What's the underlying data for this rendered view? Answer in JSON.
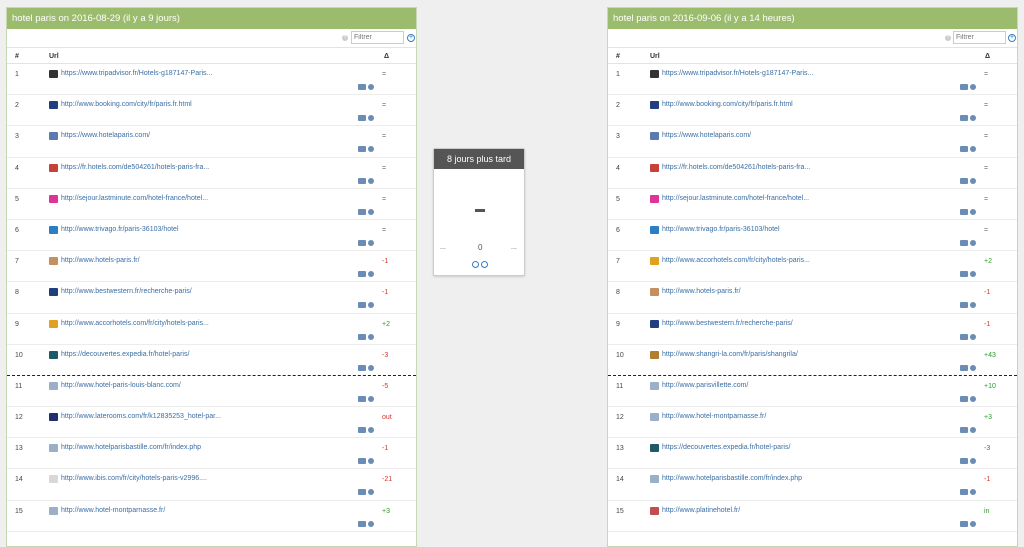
{
  "left": {
    "title": "hotel paris on 2016-08-29 (il y a 9 jours)",
    "filter_placeholder": "Filtrer",
    "col_num": "#",
    "col_url": "Url",
    "col_delta": "Δ",
    "rows": [
      {
        "n": "1",
        "url": "https://www.tripadvisor.fr/Hotels-g187147-Paris...",
        "delta": "=",
        "fav": "#333"
      },
      {
        "n": "2",
        "url": "http://www.booking.com/city/fr/paris.fr.html",
        "delta": "=",
        "fav": "#1f3f7f"
      },
      {
        "n": "3",
        "url": "https://www.hotelaparis.com/",
        "delta": "=",
        "fav": "#5a7ab0"
      },
      {
        "n": "4",
        "url": "https://fr.hotels.com/de504261/hotels-paris-fra...",
        "delta": "=",
        "fav": "#c8403a"
      },
      {
        "n": "5",
        "url": "http://sejour.lastminute.com/hotel-france/hotel...",
        "delta": "=",
        "fav": "#e0339a"
      },
      {
        "n": "6",
        "url": "http://www.trivago.fr/paris-36103/hotel",
        "delta": "=",
        "fav": "#2a7fc4"
      },
      {
        "n": "7",
        "url": "http://www.hotels-paris.fr/",
        "delta": "-1",
        "fav": "#c49060"
      },
      {
        "n": "8",
        "url": "http://www.bestwestern.fr/recherche-paris/",
        "delta": "-1",
        "fav": "#1f3f7f"
      },
      {
        "n": "9",
        "url": "http://www.accorhotels.com/fr/city/hotels-paris...",
        "delta": "+2",
        "fav": "#e0a020"
      },
      {
        "n": "10",
        "url": "https://decouvertes.expedia.fr/hotel-paris/",
        "delta": "-3",
        "fav": "#1f5a6a"
      },
      {
        "n": "11",
        "url": "http://www.hotel-paris-louis-blanc.com/",
        "delta": "-5",
        "fav": "#9ab0c8"
      },
      {
        "n": "12",
        "url": "http://www.laterooms.com/fr/k12835253_hotel-par...",
        "delta": "out",
        "fav": "#1f2f6f"
      },
      {
        "n": "13",
        "url": "http://www.hotelparisbastille.com/fr/index.php",
        "delta": "-1",
        "fav": "#9ab0c8"
      },
      {
        "n": "14",
        "url": "http://www.ibis.com/fr/city/hotels-paris-v2996....",
        "delta": "-21",
        "fav": "#d8d8d8"
      },
      {
        "n": "15",
        "url": "http://www.hotel-montparnasse.fr/",
        "delta": "+3",
        "fav": "#9ab0c8"
      }
    ]
  },
  "right": {
    "title": "hotel paris on 2016-09-06 (il y a 14 heures)",
    "filter_placeholder": "Filtrer",
    "col_num": "#",
    "col_url": "Url",
    "col_delta": "Δ",
    "rows": [
      {
        "n": "1",
        "url": "https://www.tripadvisor.fr/Hotels-g187147-Paris...",
        "delta": "=",
        "fav": "#333"
      },
      {
        "n": "2",
        "url": "http://www.booking.com/city/fr/paris.fr.html",
        "delta": "=",
        "fav": "#1f3f7f"
      },
      {
        "n": "3",
        "url": "https://www.hotelaparis.com/",
        "delta": "=",
        "fav": "#5a7ab0"
      },
      {
        "n": "4",
        "url": "https://fr.hotels.com/de504261/hotels-paris-fra...",
        "delta": "=",
        "fav": "#c8403a"
      },
      {
        "n": "5",
        "url": "http://sejour.lastminute.com/hotel-france/hotel...",
        "delta": "=",
        "fav": "#e0339a"
      },
      {
        "n": "6",
        "url": "http://www.trivago.fr/paris-36103/hotel",
        "delta": "=",
        "fav": "#2a7fc4"
      },
      {
        "n": "7",
        "url": "http://www.accorhotels.com/fr/city/hotels-paris...",
        "delta": "+2",
        "fav": "#e0a020"
      },
      {
        "n": "8",
        "url": "http://www.hotels-paris.fr/",
        "delta": "-1",
        "fav": "#c49060"
      },
      {
        "n": "9",
        "url": "http://www.bestwestern.fr/recherche-paris/",
        "delta": "-1",
        "fav": "#1f3f7f"
      },
      {
        "n": "10",
        "url": "http://www.shangri-la.com/fr/paris/shangrila/",
        "delta": "+43",
        "fav": "#b08030"
      },
      {
        "n": "11",
        "url": "http://www.parisvillette.com/",
        "delta": "+10",
        "fav": "#9ab0c8"
      },
      {
        "n": "12",
        "url": "http://www.hotel-montparnasse.fr/",
        "delta": "+3",
        "fav": "#9ab0c8"
      },
      {
        "n": "13",
        "url": "https://decouvertes.expedia.fr/hotel-paris/",
        "delta": "-3",
        "fav": "#1f5a6a"
      },
      {
        "n": "14",
        "url": "http://www.hotelparisbastille.com/fr/index.php",
        "delta": "-1",
        "fav": "#9ab0c8"
      },
      {
        "n": "15",
        "url": "http://www.platinehotel.fr/",
        "delta": "in",
        "fav": "#c05050"
      }
    ]
  },
  "middle": {
    "title": "8 jours plus tard",
    "dash": "–",
    "ellipsis_left": "...",
    "zero": "0",
    "ellipsis_right": "..."
  }
}
